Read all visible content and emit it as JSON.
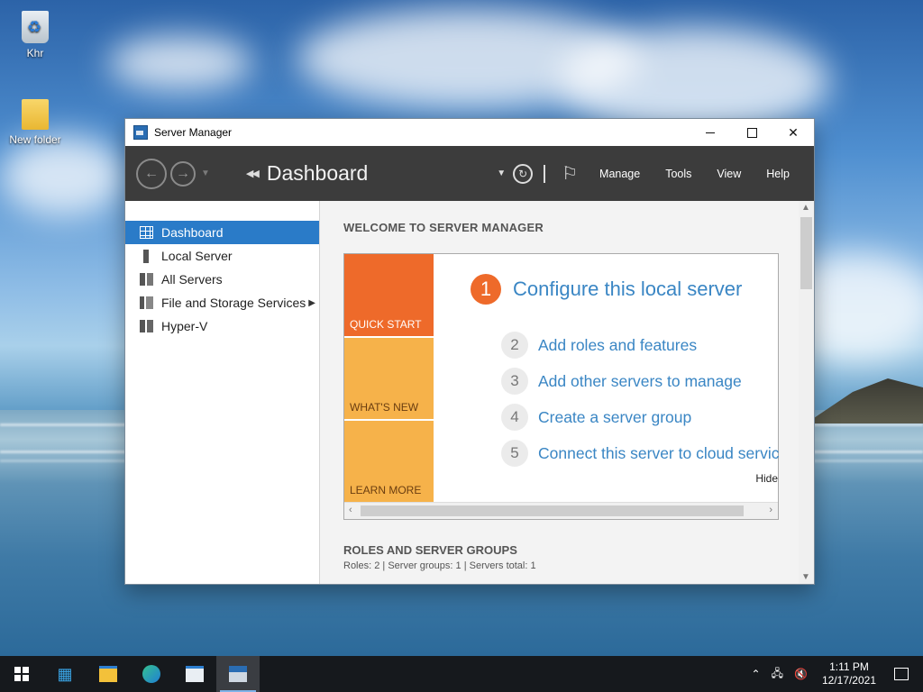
{
  "desktop": {
    "icons": [
      {
        "label": "Khr",
        "icon": "recycle-bin-icon"
      },
      {
        "label": "New folder",
        "icon": "folder-icon"
      }
    ]
  },
  "window": {
    "title": "Server Manager",
    "controls": {
      "minimize": "minimize",
      "maximize": "maximize",
      "close": "✕"
    }
  },
  "toolbar": {
    "breadcrumb": "Dashboard",
    "menus": [
      "Manage",
      "Tools",
      "View",
      "Help"
    ]
  },
  "sidebar": {
    "items": [
      {
        "label": "Dashboard",
        "icon": "dashboard-grid-icon",
        "active": true
      },
      {
        "label": "Local Server",
        "icon": "server-icon"
      },
      {
        "label": "All Servers",
        "icon": "servers-icon"
      },
      {
        "label": "File and Storage Services",
        "icon": "storage-icon",
        "has_submenu": true
      },
      {
        "label": "Hyper-V",
        "icon": "hyperv-icon"
      }
    ]
  },
  "main": {
    "welcome_heading": "WELCOME TO SERVER MANAGER",
    "tiles": [
      "QUICK START",
      "WHAT'S NEW",
      "LEARN MORE"
    ],
    "steps": [
      {
        "num": "1",
        "label": "Configure this local server"
      },
      {
        "num": "2",
        "label": "Add roles and features"
      },
      {
        "num": "3",
        "label": "Add other servers to manage"
      },
      {
        "num": "4",
        "label": "Create a server group"
      },
      {
        "num": "5",
        "label": "Connect this server to cloud servic"
      }
    ],
    "hide_label": "Hide",
    "roles_heading": "ROLES AND SERVER GROUPS",
    "roles_summary": "Roles: 2   |   Server groups: 1   |   Servers total: 1"
  },
  "taskbar": {
    "apps": [
      "start-icon",
      "server-manager-icon",
      "file-explorer-icon",
      "edge-icon",
      "app-window-icon",
      "server-manager-active-icon"
    ],
    "time": "1:11 PM",
    "date": "12/17/2021"
  },
  "colors": {
    "accent": "#2a7bc8",
    "quickstart": "#ee6a2a",
    "tile_secondary": "#f6b24a",
    "link": "#3a86c4",
    "toolbar": "#3c3c3c"
  }
}
